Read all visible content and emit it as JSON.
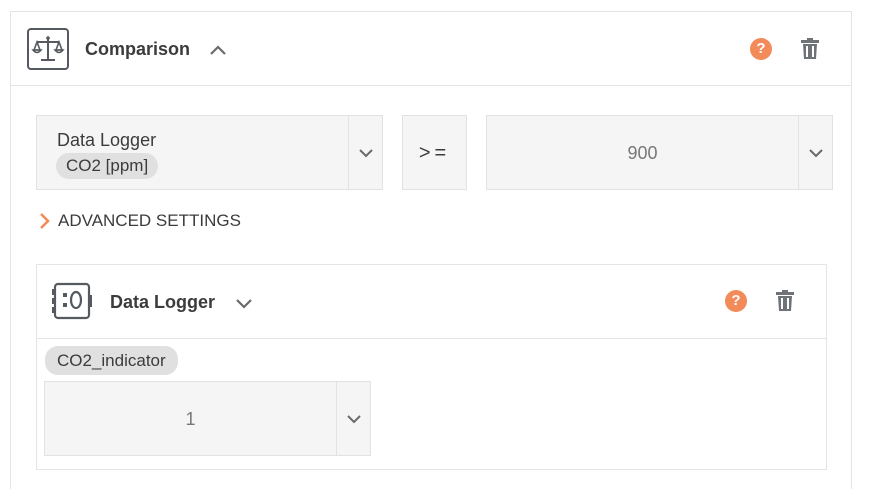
{
  "comparison": {
    "title": "Comparison",
    "icon": "balance-scale-icon",
    "left_select": {
      "source": "Data Logger",
      "channel": "CO2 [ppm]"
    },
    "operator": ">=",
    "right_select": {
      "value": "900"
    },
    "advanced_label": "ADVANCED SETTINGS",
    "help_label": "?",
    "accent_color": "#f28a5a"
  },
  "data_logger": {
    "title": "Data Logger",
    "icon": "data-logger-icon",
    "help_label": "?",
    "variable_chip": "CO2_indicator",
    "value_select": {
      "value": "1"
    }
  }
}
